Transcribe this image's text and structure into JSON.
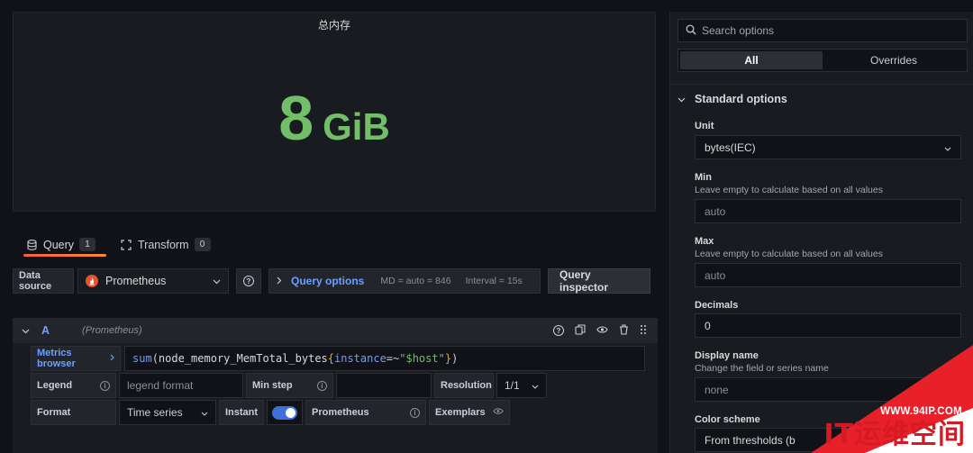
{
  "panel": {
    "title": "总内存",
    "stat_value": "8",
    "stat_unit": "GiB"
  },
  "tabs": [
    {
      "label": "Query",
      "count": "1"
    },
    {
      "label": "Transform",
      "count": "0"
    }
  ],
  "datasource": {
    "label": "Data source",
    "value": "Prometheus",
    "query_options_label": "Query options",
    "md_text": "MD = auto = 846",
    "interval_text": "Interval = 15s",
    "inspector_label": "Query inspector"
  },
  "query": {
    "ref_id": "A",
    "datasource_hint": "(Prometheus)",
    "metrics_browser_label": "Metrics browser",
    "expr_func": "sum",
    "expr_metric": "node_memory_MemTotal_bytes",
    "expr_label_key": "instance",
    "expr_op": "=~",
    "expr_label_value": "\"$host\"",
    "legend_label": "Legend",
    "legend_placeholder": "legend format",
    "min_step_label": "Min step",
    "resolution_label": "Resolution",
    "resolution_value": "1/1",
    "format_label": "Format",
    "format_value": "Time series",
    "instant_label": "Instant",
    "instant_enabled": true,
    "type_label": "Prometheus",
    "exemplars_label": "Exemplars"
  },
  "options": {
    "search_placeholder": "Search options",
    "seg_all": "All",
    "seg_overrides": "Overrides",
    "section_title": "Standard options",
    "unit_label": "Unit",
    "unit_value": "bytes(IEC)",
    "min_label": "Min",
    "min_desc": "Leave empty to calculate based on all values",
    "min_placeholder": "auto",
    "max_label": "Max",
    "max_desc": "Leave empty to calculate based on all values",
    "max_placeholder": "auto",
    "decimals_label": "Decimals",
    "decimals_value": "0",
    "display_name_label": "Display name",
    "display_name_desc": "Change the field or series name",
    "display_name_placeholder": "none",
    "color_scheme_label": "Color scheme",
    "color_scheme_value": "From thresholds (b"
  },
  "watermark": {
    "url": "WWW.94IP.COM",
    "brand": "IT运维空间"
  },
  "colors": {
    "stat_green": "#73bf69",
    "accent_orange": "#ff7a33",
    "link_blue": "#6e9fff",
    "watermark_red": "#e8202a"
  }
}
